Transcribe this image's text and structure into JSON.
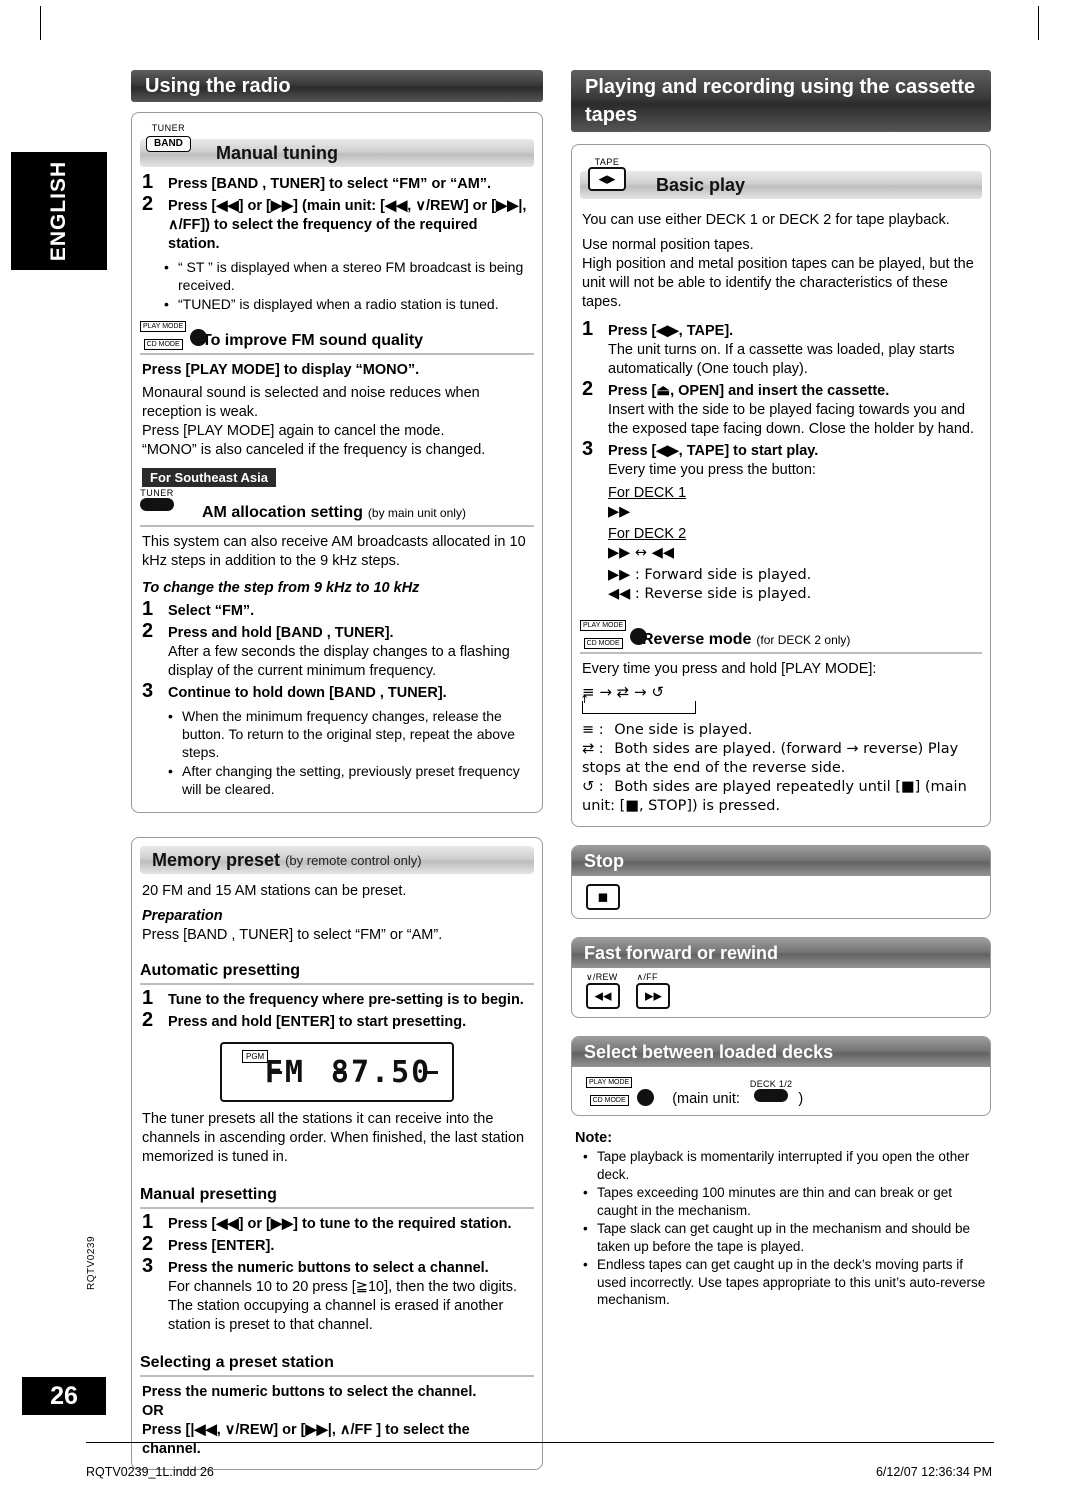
{
  "sidebar": {
    "language": "ENGLISH",
    "page_number": "26",
    "doc_code": "RQTV0239"
  },
  "left_column": {
    "chapter_title": "Using the radio",
    "manual_tuning": {
      "key_top_label": "TUNER",
      "key_label": "BAND",
      "title": "Manual tuning",
      "steps": [
        {
          "num": "1",
          "text": "Press [BAND , TUNER] to select “FM” or “AM”."
        },
        {
          "num": "2",
          "text": "Press [◀◀] or [▶▶] (main unit: [◀◀, ∨/REW] or [▶▶|, ∧/FF]) to select the frequency of the required station."
        }
      ],
      "bullets": [
        "“ ST ” is displayed when a stereo FM broadcast is being received.",
        "“TUNED” is displayed when a radio station is tuned."
      ]
    },
    "fm_sound_quality": {
      "key_top_label": "PLAY MODE",
      "key_sub_label": "CD MODE",
      "title": "To improve FM sound quality",
      "bold_line": "Press [PLAY MODE] to display “MONO”.",
      "paragraphs": [
        "Monaural sound is selected and noise reduces when reception is weak.",
        "Press [PLAY MODE] again to cancel the mode.",
        "“MONO” is also canceled if the frequency is changed."
      ]
    },
    "southeast_asia_tag": "For Southeast Asia",
    "am_allocation": {
      "key_top_label": "TUNER",
      "title": "AM allocation setting",
      "subtitle": "(by main unit only)",
      "intro": "This system can also receive AM broadcasts allocated in 10 kHz steps in addition to the 9 kHz steps.",
      "change_step_title": "To change the step from 9 kHz to 10 kHz",
      "steps": [
        {
          "num": "1",
          "text": "Select “FM”."
        },
        {
          "num": "2",
          "bold": "Press and hold [BAND , TUNER].",
          "text": "After a few seconds the display changes to a flashing display of the current minimum frequency."
        },
        {
          "num": "3",
          "bold": "Continue to hold down [BAND , TUNER]."
        }
      ],
      "bullets": [
        "When the minimum frequency changes, release the button. To return to the original step, repeat the above steps.",
        "After changing the setting, previously preset frequency will be cleared."
      ]
    },
    "memory_preset": {
      "title": "Memory preset",
      "subtitle": "(by remote control only)",
      "intro": "20 FM and 15 AM stations can be preset.",
      "preparation_label": "Preparation",
      "preparation_text": "Press [BAND , TUNER] to select “FM” or “AM”.",
      "auto_presetting": {
        "title": "Automatic presetting",
        "steps": [
          {
            "num": "1",
            "text": "Tune to the frequency where pre-setting is to begin."
          },
          {
            "num": "2",
            "text": "Press and hold [ENTER] to start presetting."
          }
        ],
        "display": {
          "tag": "PGM",
          "band": "FM",
          "frequency": "87.50"
        },
        "after_text": "The tuner presets all the stations it can receive into the channels in ascending order. When finished, the last station memorized is tuned in."
      },
      "manual_presetting": {
        "title": "Manual presetting",
        "steps": [
          {
            "num": "1",
            "text": "Press [◀◀] or [▶▶] to tune to the required station."
          },
          {
            "num": "2",
            "text": "Press [ENTER]."
          },
          {
            "num": "3",
            "bold": "Press the numeric buttons to select a channel.",
            "text": "For channels 10 to 20 press [≧10], then the two digits. The station occupying a channel is erased if another station is preset to that channel."
          }
        ]
      },
      "selecting_preset": {
        "title": "Selecting a preset station",
        "line1": "Press the numeric buttons to select the channel.",
        "or": "OR",
        "line2": "Press [|◀◀, ∨/REW] or [▶▶|, ∧/FF ] to select the channel."
      }
    }
  },
  "right_column": {
    "chapter_title": "Playing and recording using the cassette tapes",
    "basic_play": {
      "key_top_label": "TAPE",
      "title": "Basic play",
      "paragraphs": [
        "You can use either DECK 1 or DECK 2 for tape playback.",
        "Use normal position tapes.",
        "High position and metal position tapes can be played, but the unit will not be able to identify the characteristics of these tapes."
      ],
      "steps": [
        {
          "num": "1",
          "bold": "Press [◀▶, TAPE].",
          "text": "The unit turns on. If a cassette was loaded, play starts automatically (One touch play)."
        },
        {
          "num": "2",
          "bold": "Press [⏏, OPEN] and insert the cassette.",
          "text": "Insert with the side to be played facing towards you and the exposed tape facing down. Close the holder by hand."
        },
        {
          "num": "3",
          "bold": "Press [◀▶, TAPE] to start play.",
          "text": "Every time you press the button:"
        }
      ],
      "deck1_label": "For DECK 1",
      "deck1_symbol": "▶▶",
      "deck2_label": "For DECK 2",
      "deck2_symbol": "▶▶ ↔ ◀◀",
      "legend": [
        "▶▶ : Forward side is played.",
        "◀◀ : Reverse side is played."
      ]
    },
    "reverse_mode": {
      "key_top_label": "PLAY MODE",
      "key_sub_label": "CD MODE",
      "title": "Reverse mode",
      "subtitle": "(for DECK 2 only)",
      "intro": "Every time you press and hold [PLAY MODE]:",
      "sequence": "≡  →  ⇄  →  ↺",
      "legend": [
        {
          "sym": "≡ :",
          "text": "One side is played."
        },
        {
          "sym": "⇄ :",
          "text": "Both sides are played. (forward → reverse) Play stops at the end of the reverse side."
        },
        {
          "sym": "↺ :",
          "text": "Both sides are played repeatedly until [■] (main unit: [■, STOP]) is pressed."
        }
      ]
    },
    "stop": {
      "title": "Stop",
      "button_glyph": "■"
    },
    "fast_forward_rewind": {
      "title": "Fast forward or rewind",
      "left_label": "∨/REW",
      "right_label": "∧/FF",
      "left_glyph": "◀◀",
      "right_glyph": "▶▶"
    },
    "select_decks": {
      "title": "Select between loaded decks",
      "key_top_label": "PLAY MODE",
      "key_sub_label": "CD MODE",
      "main_unit_text": "(main unit:",
      "deck_label": "DECK 1/2",
      "close_paren": ")"
    },
    "note": {
      "title": "Note:",
      "items": [
        "Tape playback is momentarily interrupted if you open the other deck.",
        "Tapes exceeding 100 minutes are thin and can break or get caught in the mechanism.",
        "Tape slack can get caught up in the mechanism and should be taken up before the tape is played.",
        "Endless tapes can get caught up in the deck’s moving parts if used incorrectly. Use tapes appropriate to this unit’s auto-reverse mechanism."
      ]
    }
  },
  "footer": {
    "left": "RQTV0239_1L.indd   26",
    "right": "6/12/07   12:36:34 PM"
  }
}
